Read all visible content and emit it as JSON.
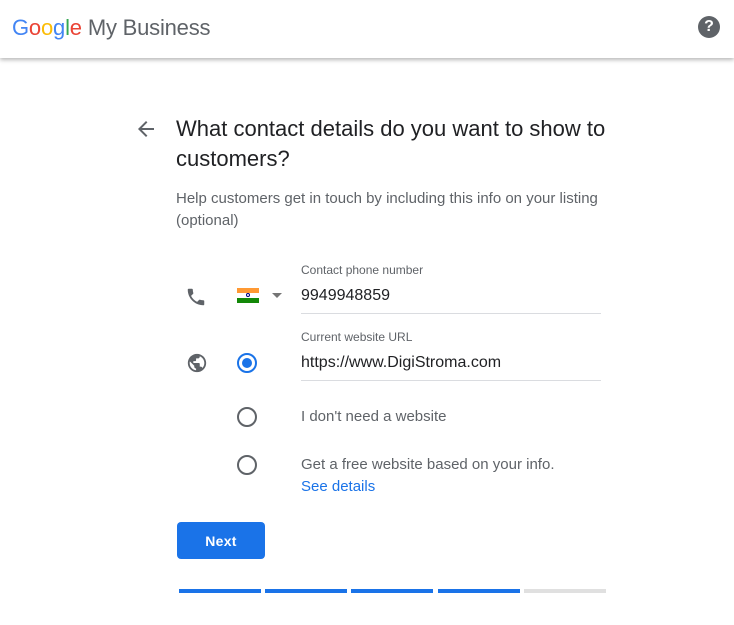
{
  "header": {
    "logo_google": [
      "G",
      "o",
      "o",
      "g",
      "l",
      "e"
    ],
    "logo_product": "My Business",
    "help_symbol": "?"
  },
  "main": {
    "title": "What contact details do you want to show to customers?",
    "subtitle": "Help customers get in touch by including this info on your listing (optional)",
    "phone": {
      "label": "Contact phone number",
      "value": "9949948859",
      "country_flag": "India"
    },
    "website": {
      "label": "Current website URL",
      "value": "https://www.DigiStroma.com",
      "options": [
        {
          "label": "I don't need a website",
          "selected": false
        },
        {
          "label": "Get a free website based on your info.",
          "link": "See details",
          "selected": false
        }
      ],
      "url_option_selected": true
    },
    "next_label": "Next"
  },
  "progress": {
    "steps_total": 5,
    "steps_completed": 4
  },
  "colors": {
    "accent": "#1a73e8",
    "text_primary": "#202124",
    "text_secondary": "#5f6368",
    "progress_inactive": "#e0e0e0"
  },
  "icons": {
    "back": "arrow-left-icon",
    "phone": "phone-icon",
    "globe": "globe-icon",
    "help": "help-circle-icon",
    "dropdown": "caret-down-icon"
  }
}
